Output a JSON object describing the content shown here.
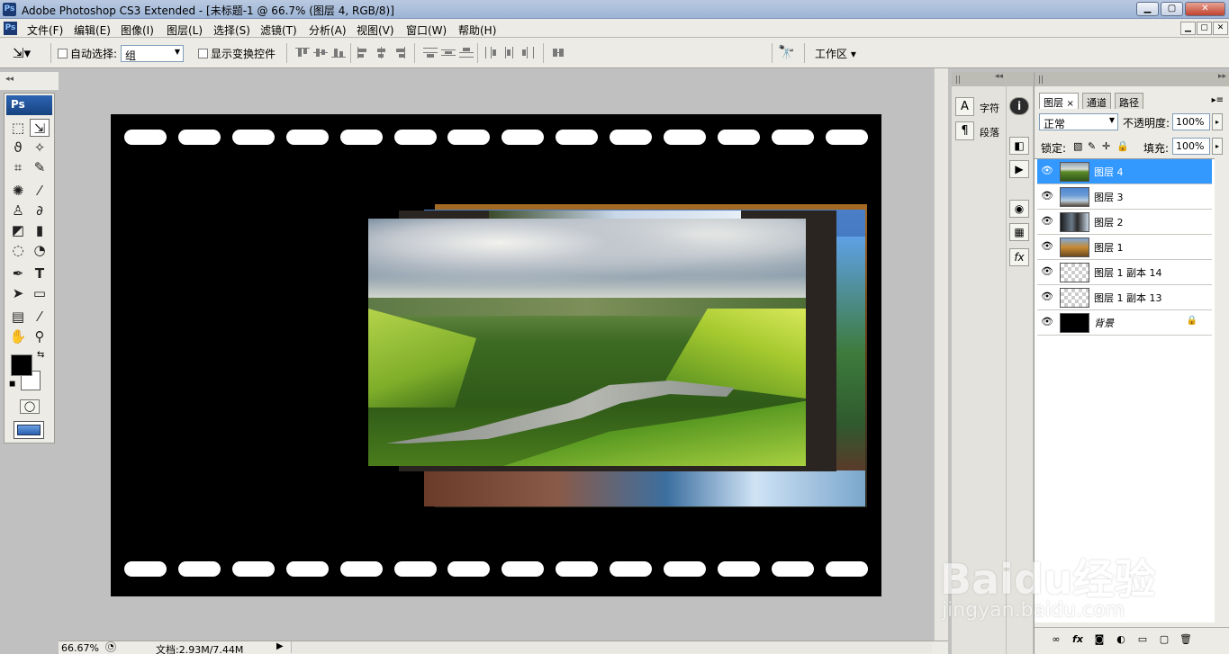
{
  "app": {
    "title": "Adobe Photoshop CS3 Extended - [未标题-1 @ 66.7% (图层 4, RGB/8)]",
    "logo": "Ps"
  },
  "window_buttons": {
    "minimize": "▁",
    "maximize": "▢",
    "close": "✕"
  },
  "menu": {
    "items": [
      "文件(F)",
      "编辑(E)",
      "图像(I)",
      "图层(L)",
      "选择(S)",
      "滤镜(T)",
      "分析(A)",
      "视图(V)",
      "窗口(W)",
      "帮助(H)"
    ]
  },
  "options": {
    "auto_select_label": "自动选择:",
    "auto_select_value": "组",
    "show_transform_label": "显示变换控件",
    "workspace_label": "工作区"
  },
  "toolbox": {
    "badge": "Ps",
    "foreground_color": "#000000",
    "background_color": "#ffffff"
  },
  "document": {
    "sprocket_count": 14,
    "background": "#000000"
  },
  "status": {
    "zoom": "66.67%",
    "doc_size": "文档:2.93M/7.44M"
  },
  "char_panel": {
    "items": [
      {
        "icon": "A",
        "label": "字符"
      },
      {
        "icon": "¶",
        "label": "段落"
      }
    ]
  },
  "layers_panel": {
    "tabs": [
      "图层",
      "通道",
      "路径"
    ],
    "close_tab_glyph": "×",
    "blend_mode": "正常",
    "opacity_label": "不透明度:",
    "opacity_value": "100%",
    "lock_label": "锁定:",
    "fill_label": "填充:",
    "fill_value": "100%",
    "layers": [
      {
        "name": "图层 4",
        "active": true,
        "thumb": "landscape"
      },
      {
        "name": "图层 3",
        "active": false,
        "thumb": "sky"
      },
      {
        "name": "图层 2",
        "active": false,
        "thumb": "dark"
      },
      {
        "name": "图层 1",
        "active": false,
        "thumb": "autumn"
      },
      {
        "name": "图层 1 副本 14",
        "active": false,
        "thumb": "transparent"
      },
      {
        "name": "图层 1 副本 13",
        "active": false,
        "thumb": "transparent"
      },
      {
        "name": "背景",
        "active": false,
        "thumb": "black"
      }
    ]
  },
  "watermark": {
    "text": "Baidu经验",
    "sub": "jingyan.baidu.com"
  }
}
